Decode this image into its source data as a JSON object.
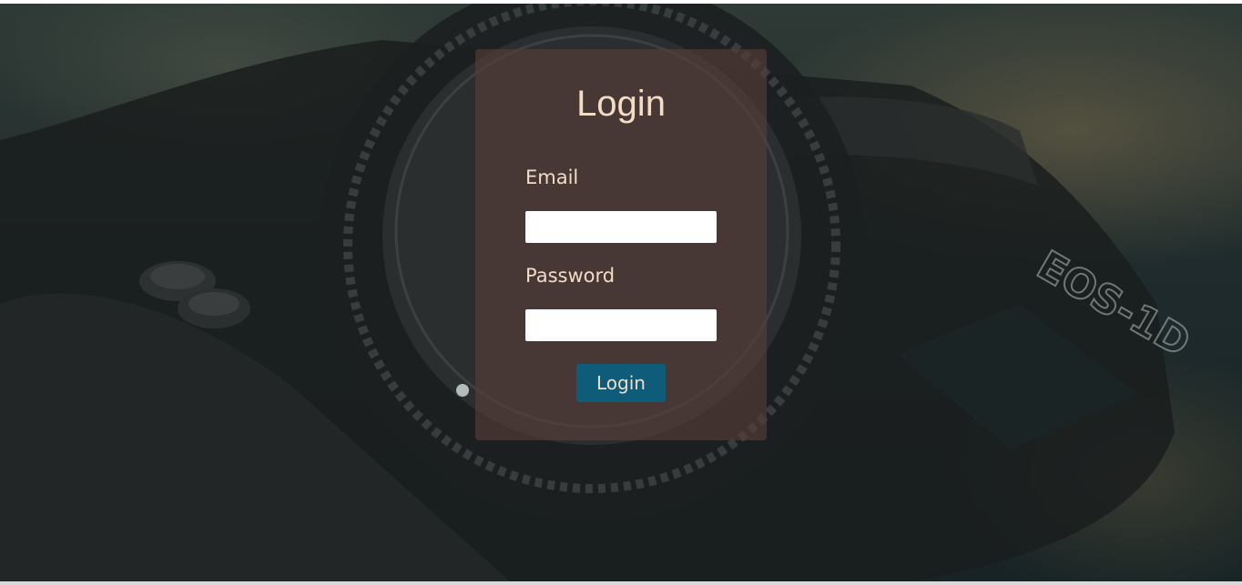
{
  "login_form": {
    "title": "Login",
    "email_label": "Email",
    "email_value": "",
    "password_label": "Password",
    "password_value": "",
    "submit_label": "Login"
  },
  "theme": {
    "panel_color": "#583e3a",
    "title_color": "#f3ddc6",
    "button_color": "#0e5b7a"
  },
  "background_photo": {
    "subject": "dslr-camera-body",
    "printed_text": "EOS-1D"
  }
}
